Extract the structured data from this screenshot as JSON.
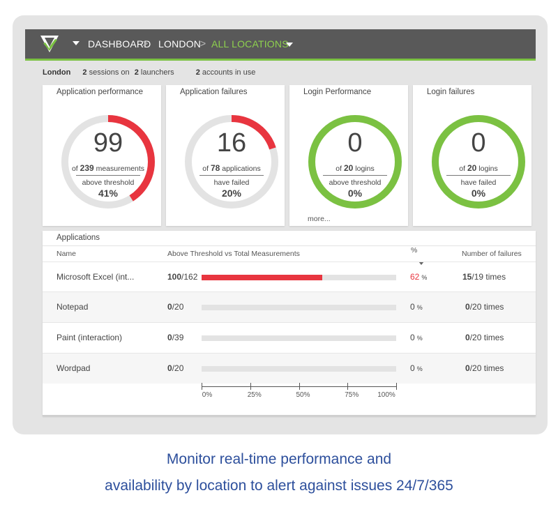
{
  "nav": {
    "items": [
      "DASHBOARD",
      "LONDON",
      "ALL LOCATIONS"
    ],
    "separator": ">"
  },
  "summary": {
    "location": "London",
    "sessions": "2",
    "sessions_label": "sessions on",
    "launchers": "2",
    "launchers_label": "launchers",
    "accounts": "2",
    "accounts_label": "accounts in use"
  },
  "cards": [
    {
      "title": "Application performance",
      "value": "99",
      "of_prefix": "of",
      "of_value": "239",
      "of_label": "measurements",
      "desc": "above threshold",
      "percent": "41%",
      "fraction": 0.41,
      "color": "#e8353f"
    },
    {
      "title": "Application failures",
      "value": "16",
      "of_prefix": "of",
      "of_value": "78",
      "of_label": "applications",
      "desc": "have failed",
      "percent": "20%",
      "fraction": 0.2,
      "color": "#e8353f"
    },
    {
      "title": "Login Performance",
      "value": "0",
      "of_prefix": "of",
      "of_value": "20",
      "of_label": "logins",
      "desc": "above threshold",
      "percent": "0%",
      "fraction": 0,
      "color": "#7bc142",
      "more": "more..."
    },
    {
      "title": "Login failures",
      "value": "0",
      "of_prefix": "of",
      "of_value": "20",
      "of_label": "logins",
      "desc": "have failed",
      "percent": "0%",
      "fraction": 0,
      "color": "#7bc142"
    }
  ],
  "applications": {
    "title": "Applications",
    "headers": {
      "name": "Name",
      "bar": "Above Threshold vs Total Measurements",
      "pct": "%",
      "failures": "Number of failures"
    },
    "rows": [
      {
        "name": "Microsoft Excel (int...",
        "above": "100",
        "total": "162",
        "pct": "62",
        "pct_unit": "%",
        "fraction": 0.62,
        "fail": "15",
        "fail_total": "19",
        "fail_unit": "times",
        "highlight": true
      },
      {
        "name": "Notepad",
        "above": "0",
        "total": "20",
        "pct": "0",
        "pct_unit": "%",
        "fraction": 0,
        "fail": "0",
        "fail_total": "20",
        "fail_unit": "times",
        "highlight": false
      },
      {
        "name": "Paint (interaction)",
        "above": "0",
        "total": "39",
        "pct": "0",
        "pct_unit": "%",
        "fraction": 0,
        "fail": "0",
        "fail_total": "20",
        "fail_unit": "times",
        "highlight": false
      },
      {
        "name": "Wordpad",
        "above": "0",
        "total": "20",
        "pct": "0",
        "pct_unit": "%",
        "fraction": 0,
        "fail": "0",
        "fail_total": "20",
        "fail_unit": "times",
        "highlight": false
      }
    ],
    "axis_ticks": [
      "0%",
      "25%",
      "50%",
      "75%",
      "100%"
    ]
  },
  "caption": {
    "line1": "Monitor real-time performance and",
    "line2": "availability by location to alert against issues 24/7/365"
  },
  "colors": {
    "accent_green": "#7bc142",
    "alert_red": "#e8353f",
    "topbar": "#595959",
    "caption": "#2d4f9c"
  }
}
